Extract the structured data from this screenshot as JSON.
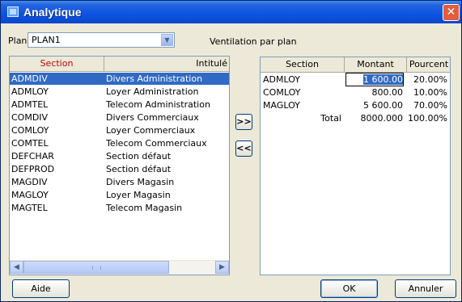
{
  "window": {
    "title": "Analytique",
    "close_glyph": "✕"
  },
  "plan": {
    "label": "Plan",
    "value": "PLAN1",
    "caption": "Ventilation par plan"
  },
  "left_table": {
    "headers": {
      "section": "Section",
      "intitule": "Intitulé"
    },
    "rows": [
      {
        "section": "ADMDIV",
        "intitule": "Divers Administration",
        "selected": true
      },
      {
        "section": "ADMLOY",
        "intitule": "Loyer Administration"
      },
      {
        "section": "ADMTEL",
        "intitule": "Telecom Administration"
      },
      {
        "section": "COMDIV",
        "intitule": "Divers Commerciaux"
      },
      {
        "section": "COMLOY",
        "intitule": "Loyer Commerciaux"
      },
      {
        "section": "COMTEL",
        "intitule": "Telecom Commerciaux"
      },
      {
        "section": "DEFCHAR",
        "intitule": "Section défaut"
      },
      {
        "section": "DEFPROD",
        "intitule": "Section défaut"
      },
      {
        "section": "MAGDIV",
        "intitule": "Divers Magasin"
      },
      {
        "section": "MAGLOY",
        "intitule": "Loyer Magasin"
      },
      {
        "section": "MAGTEL",
        "intitule": "Telecom Magasin"
      }
    ]
  },
  "right_table": {
    "headers": {
      "section": "Section",
      "montant": "Montant",
      "pourcent": "Pourcent"
    },
    "rows": [
      {
        "section": "ADMLOY",
        "montant": "1 600.00",
        "pourcent": "20.00%",
        "editing": true
      },
      {
        "section": "COMLOY",
        "montant": "800.00",
        "pourcent": "10.00%"
      },
      {
        "section": "MAGLOY",
        "montant": "5 600.00",
        "pourcent": "70.00%"
      }
    ],
    "total": {
      "label": "Total",
      "montant": "8000.000",
      "pourcent": "100.00%"
    }
  },
  "move_buttons": {
    "add": ">>",
    "remove": "<<"
  },
  "buttons": {
    "help": "Aide",
    "ok": "OK",
    "cancel": "Annuler"
  },
  "colors": {
    "title_bar": "#0a47cc",
    "selection": "#316ac5",
    "section_header_text": "#c00000",
    "close_button": "#e35c3c"
  }
}
